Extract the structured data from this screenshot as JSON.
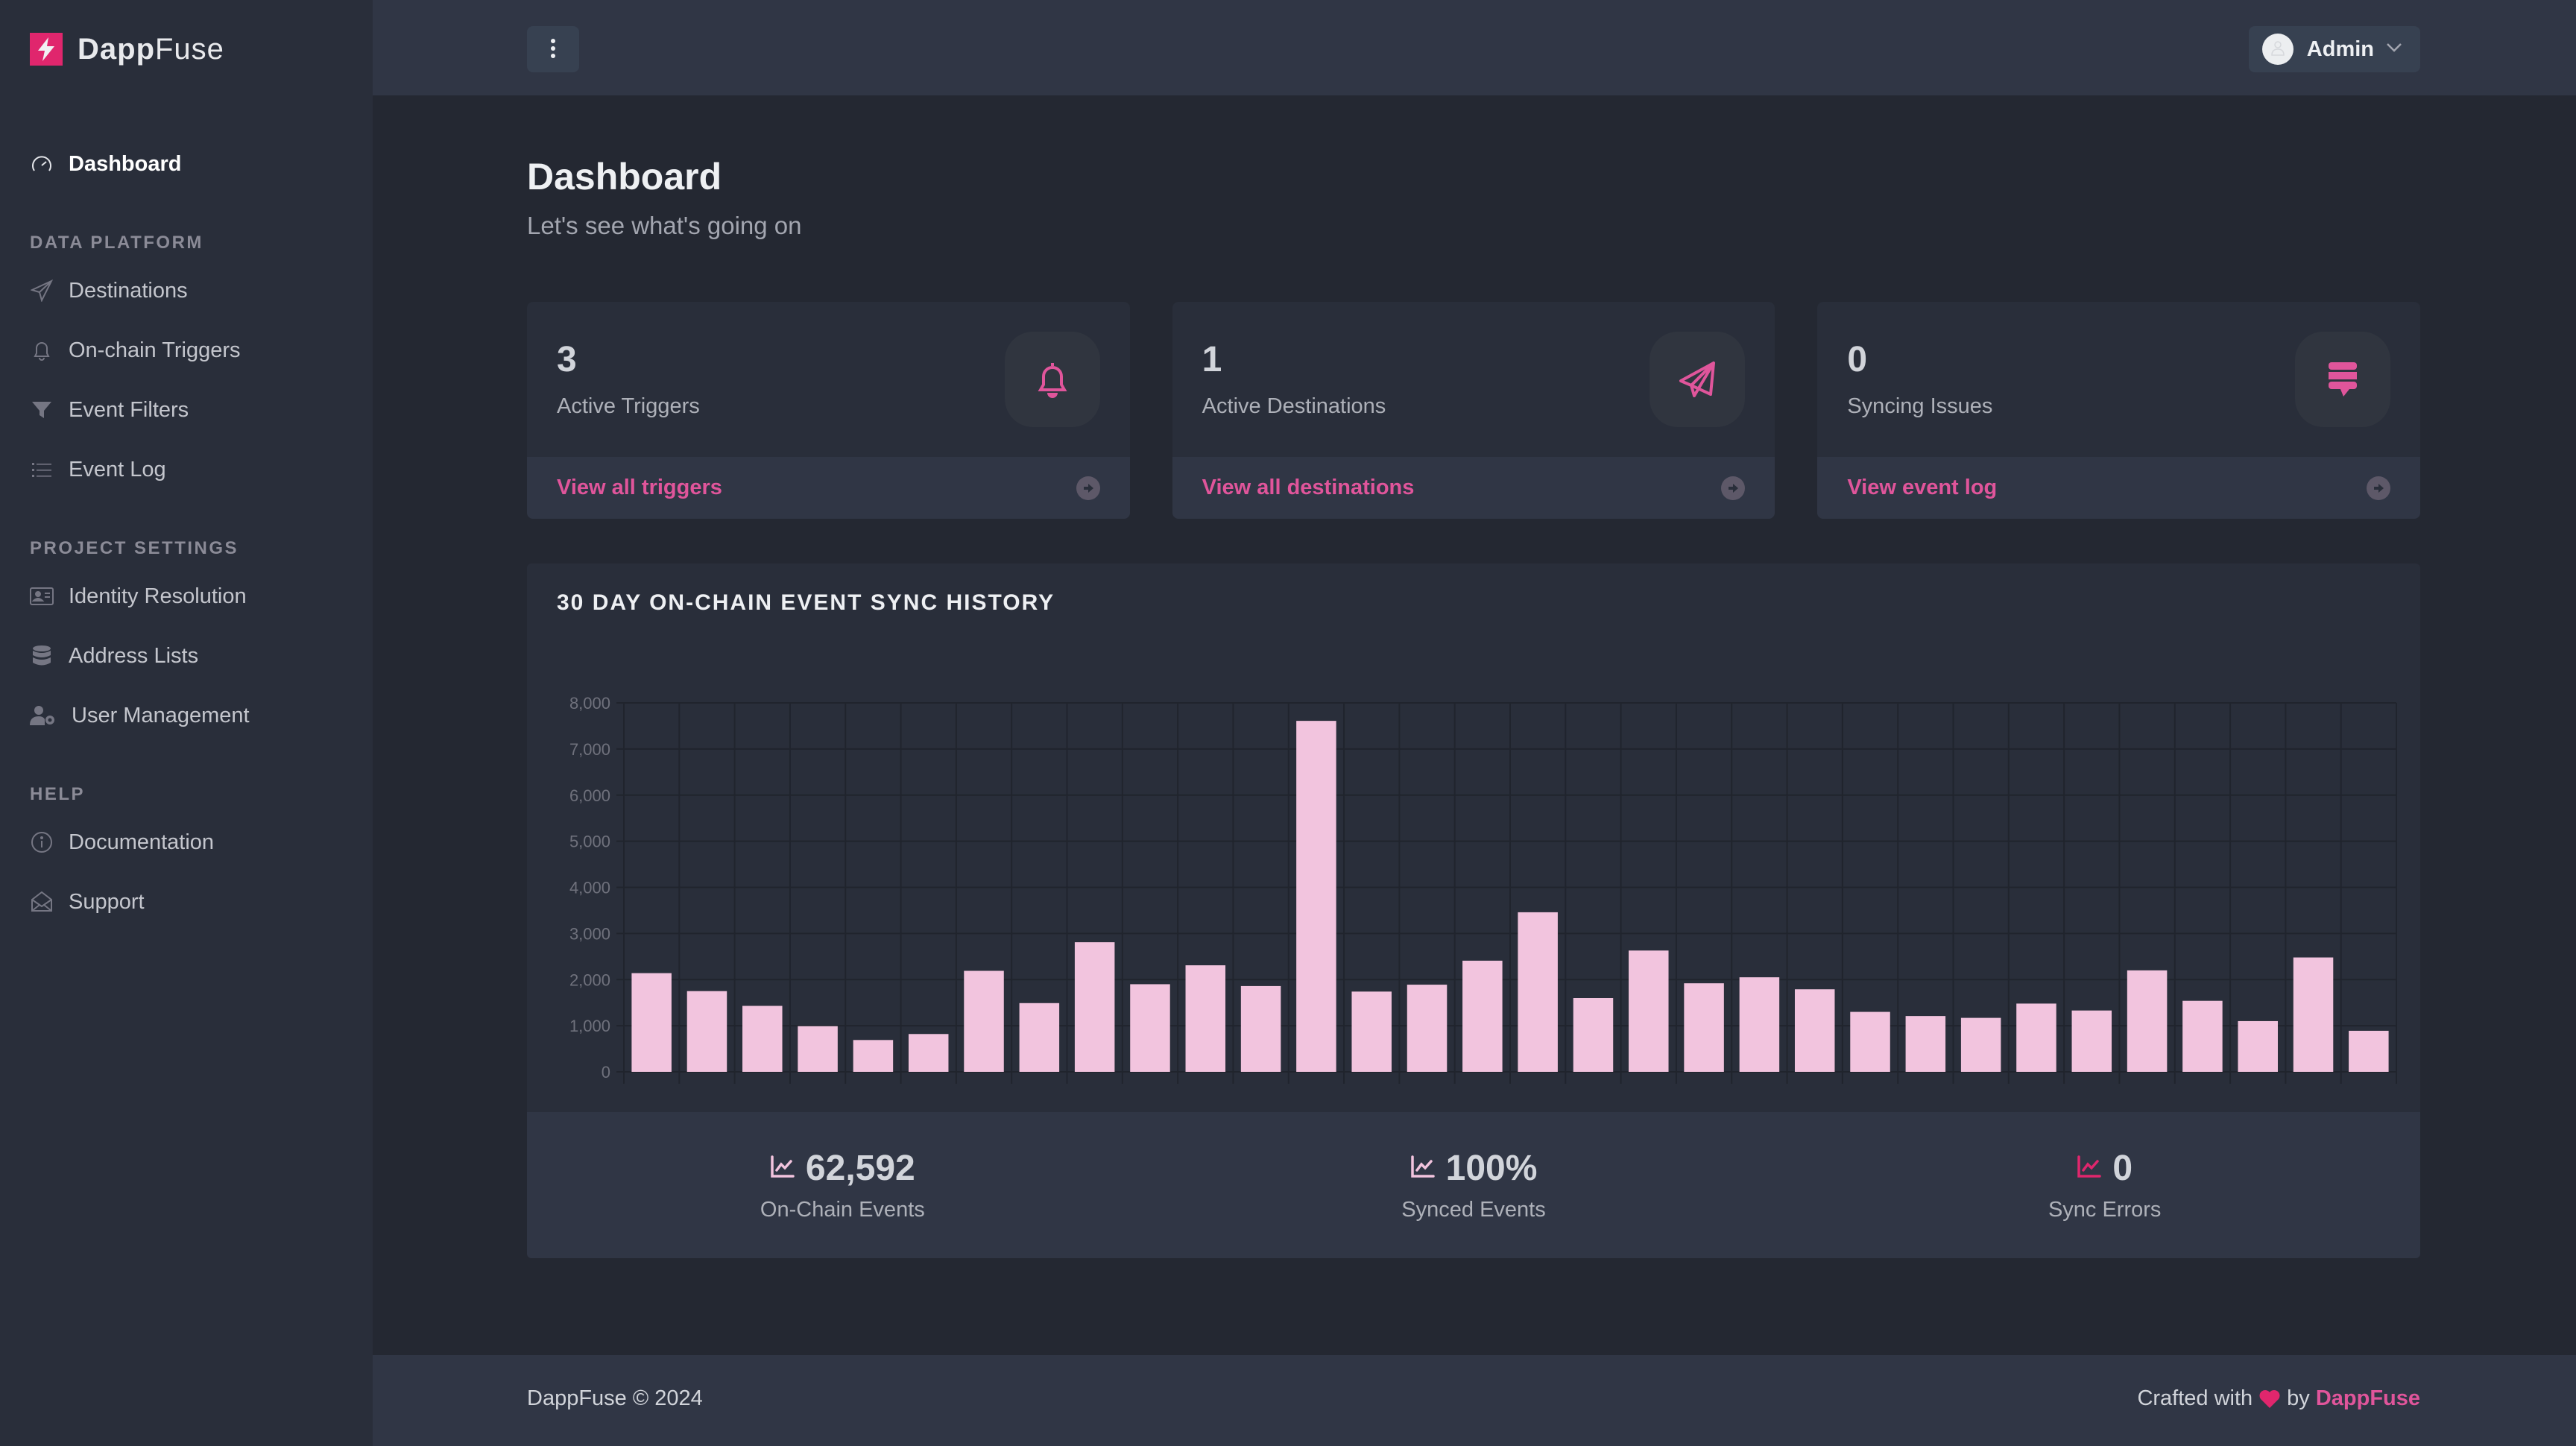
{
  "brand": {
    "name_bold": "Dapp",
    "name_rest": "Fuse",
    "logo_color": "#e0266d",
    "logo_icon": "bolt-icon"
  },
  "sidebar": {
    "items": [
      {
        "label": "Dashboard",
        "icon": "gauge-icon",
        "active": true
      }
    ],
    "sections": [
      {
        "heading": "DATA PLATFORM",
        "items": [
          {
            "label": "Destinations",
            "icon": "paper-plane-icon"
          },
          {
            "label": "On-chain Triggers",
            "icon": "bell-icon"
          },
          {
            "label": "Event Filters",
            "icon": "filter-icon"
          },
          {
            "label": "Event Log",
            "icon": "list-icon"
          }
        ]
      },
      {
        "heading": "PROJECT SETTINGS",
        "items": [
          {
            "label": "Identity Resolution",
            "icon": "id-card-icon"
          },
          {
            "label": "Address Lists",
            "icon": "database-icon"
          },
          {
            "label": "User Management",
            "icon": "user-gear-icon"
          }
        ]
      },
      {
        "heading": "HELP",
        "items": [
          {
            "label": "Documentation",
            "icon": "info-icon"
          },
          {
            "label": "Support",
            "icon": "envelope-open-icon"
          }
        ]
      }
    ]
  },
  "header": {
    "menu_icon": "ellipsis-vertical-icon",
    "user": {
      "name": "Admin",
      "avatar_icon": "user-icon",
      "chevron": "chevron-down-icon"
    }
  },
  "page": {
    "title": "Dashboard",
    "subtitle": "Let's see what's going on"
  },
  "cards": [
    {
      "value": "3",
      "label": "Active Triggers",
      "icon": "bell-icon",
      "link": "View all triggers"
    },
    {
      "value": "1",
      "label": "Active Destinations",
      "icon": "paper-plane-icon",
      "link": "View all destinations"
    },
    {
      "value": "0",
      "label": "Syncing Issues",
      "icon": "comment-list-icon",
      "link": "View event log"
    }
  ],
  "accent_color": "#e0559b",
  "chart_data": {
    "type": "bar",
    "title": "30 DAY ON-CHAIN EVENT SYNC HISTORY",
    "xlabel": "",
    "ylabel": "",
    "ylim": [
      0,
      8000
    ],
    "yticks": [
      0,
      1000,
      2000,
      3000,
      4000,
      5000,
      6000,
      7000,
      8000
    ],
    "ytick_labels": [
      "0",
      "1,000",
      "2,000",
      "3,000",
      "4,000",
      "5,000",
      "6,000",
      "7,000",
      "8,000"
    ],
    "grid": true,
    "bar_color": "#f2c4de",
    "values": [
      2140,
      1750,
      1430,
      990,
      690,
      820,
      2190,
      1490,
      2810,
      1900,
      2310,
      1860,
      7610,
      1740,
      1890,
      2410,
      3460,
      1600,
      2630,
      1920,
      2050,
      1790,
      1300,
      1210,
      1170,
      1480,
      1330,
      2200,
      1540,
      1100,
      2480,
      890
    ]
  },
  "stats": [
    {
      "value": "62,592",
      "label": "On-Chain Events",
      "icon": "chart-line-icon",
      "icon_color": "#f2c4de"
    },
    {
      "value": "100%",
      "label": "Synced Events",
      "icon": "chart-line-icon",
      "icon_color": "#f2c4de"
    },
    {
      "value": "0",
      "label": "Sync Errors",
      "icon": "chart-line-icon",
      "icon_color": "#e0266d"
    }
  ],
  "footer": {
    "copyright": "DappFuse © 2024",
    "crafted_prefix": "Crafted with",
    "crafted_by": "by",
    "crafted_brand": "DappFuse",
    "heart_color": "#e0266d"
  }
}
